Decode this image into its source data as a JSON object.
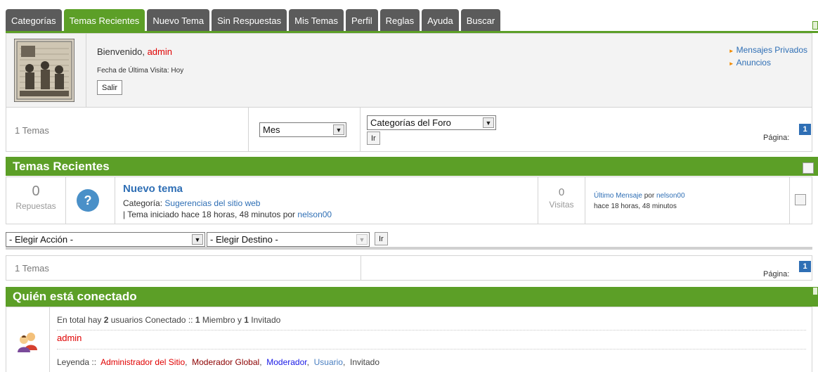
{
  "tabs": [
    {
      "label": "Categorías",
      "active": false
    },
    {
      "label": "Temas Recientes",
      "active": true
    },
    {
      "label": "Nuevo Tema",
      "active": false
    },
    {
      "label": "Sin Respuestas",
      "active": false
    },
    {
      "label": "Mis Temas",
      "active": false
    },
    {
      "label": "Perfil",
      "active": false
    },
    {
      "label": "Reglas",
      "active": false
    },
    {
      "label": "Ayuda",
      "active": false
    },
    {
      "label": "Buscar",
      "active": false
    }
  ],
  "welcome": {
    "greeting": "Bienvenido,",
    "username": "admin",
    "last_visit_label": "Fecha de Última Visita:",
    "last_visit_value": "Hoy",
    "logout_label": "Salir",
    "links": [
      "Mensajes Privados",
      "Anuncios"
    ]
  },
  "filter": {
    "topics_count": "1 Temas",
    "period_select": "Mes",
    "category_select": "Categorías del Foro",
    "go_label": "Ir",
    "page_label": "Página:",
    "page_number": "1"
  },
  "recent": {
    "header": "Temas Recientes",
    "topic": {
      "replies": "0",
      "replies_label": "Repuestas",
      "title": "Nuevo tema",
      "category_label": "Categoría:",
      "category_value": "Sugerencias del sitio web",
      "started_text": "| Tema iniciado hace 18 horas, 48 minutos por",
      "started_by": "nelson00",
      "views": "0",
      "views_label": "Visitas",
      "last_msg_label": "Último Mensaje",
      "last_msg_by_label": "por",
      "last_msg_user": "nelson00",
      "last_msg_time": "hace 18 horas, 48 minutos"
    },
    "action_select": "- Elegir Acción -",
    "destination_select": "- Elegir Destino -",
    "go_label": "Ir"
  },
  "bottom": {
    "topics_count": "1 Temas",
    "page_label": "Página:",
    "page_number": "1"
  },
  "online": {
    "header": "Quién está conectado",
    "summary_prefix": "En total hay",
    "total": "2",
    "summary_mid": "usuarios Conectado ::",
    "members": "1",
    "members_label": "Miembro y",
    "guests": "1",
    "guests_label": "Invitado",
    "online_user": "admin",
    "legend_label": "Leyenda ::",
    "legend": {
      "admin": "Administrador del Sitio",
      "global_mod": "Moderador Global",
      "mod": "Moderador",
      "user": "Usuario",
      "guest": "Invitado"
    }
  },
  "colors": {
    "accent": "#5c9f27",
    "tab": "#5b5b5b",
    "link": "#2f6fb5",
    "admin": "#e00000"
  }
}
